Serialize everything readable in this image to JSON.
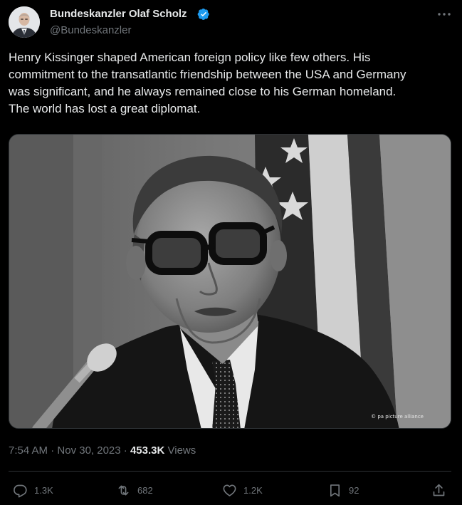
{
  "author": {
    "display_name": "Bundeskanzler Olaf Scholz",
    "handle": "@Bundeskanzler",
    "verified": true,
    "verified_color": "#1d9bf0"
  },
  "tweet": {
    "text": "Henry Kissinger shaped American foreign policy like few others. His\ncommitment to the transatlantic friendship between the USA and Germany\nwas significant, and he always remained close to his German homeland.\nThe world has lost a great diplomat."
  },
  "media": {
    "credit": "© pa picture alliance"
  },
  "meta": {
    "time": "7:54 AM",
    "separator": " · ",
    "date": "Nov 30, 2023",
    "views_count": "453.3K",
    "views_label": "Views"
  },
  "actions": {
    "replies": "1.3K",
    "reposts": "682",
    "likes": "1.2K",
    "bookmarks": "92"
  },
  "icons": [
    "more-icon",
    "verified-icon",
    "reply-icon",
    "retweet-icon",
    "like-icon",
    "bookmark-icon",
    "share-icon"
  ],
  "colors": {
    "background": "#000000",
    "text_primary": "#e7e9ea",
    "text_secondary": "#71767b",
    "divider": "#2f3336"
  }
}
